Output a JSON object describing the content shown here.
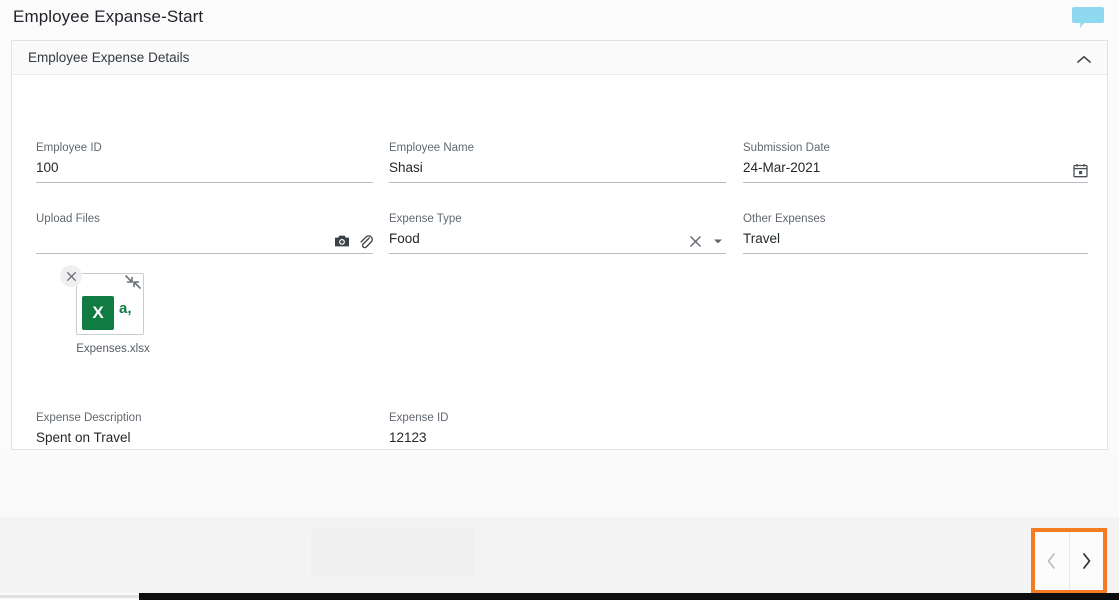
{
  "header": {
    "title": "Employee Expanse-Start",
    "chat_icon": "speech-bubble-icon",
    "chat_color": "#8ed8f0"
  },
  "panel": {
    "title": "Employee Expense Details",
    "collapse_icon": "chevron-up-icon",
    "collapsed": false
  },
  "fields": {
    "employee_id": {
      "label": "Employee ID",
      "value": "100",
      "placeholder": ""
    },
    "employee_name": {
      "label": "Employee Name",
      "value": "Shasi",
      "placeholder": ""
    },
    "submission_date": {
      "label": "Submission Date",
      "value": "24-Mar-2021",
      "placeholder": "",
      "icon": "calendar-icon"
    },
    "upload_files": {
      "label": "Upload Files",
      "value": "",
      "placeholder": "",
      "camera_icon": "camera-icon",
      "attach_icon": "paperclip-icon"
    },
    "expense_type": {
      "label": "Expense Type",
      "value": "Food",
      "placeholder": "",
      "clear_icon": "close-icon",
      "dropdown_icon": "chevron-down-icon"
    },
    "other_expenses": {
      "label": "Other Expenses",
      "value": "Travel",
      "placeholder": ""
    },
    "expense_description": {
      "label": "Expense Description",
      "value": "Spent on Travel",
      "placeholder": ""
    },
    "expense_id": {
      "label": "Expense ID",
      "value": "12123",
      "placeholder": ""
    }
  },
  "attachment": {
    "file_name": "Expenses.xlsx",
    "file_type_glyph": "X",
    "preview_text": "a,",
    "excel_green": "#107c41",
    "remove_icon": "close-icon",
    "expand_icon": "expand-arrows-icon"
  },
  "footer": {
    "prev_label": "‹",
    "next_label": "›",
    "prev_icon": "chevron-left-icon",
    "next_icon": "chevron-right-icon",
    "highlight_color": "#f47b20"
  }
}
